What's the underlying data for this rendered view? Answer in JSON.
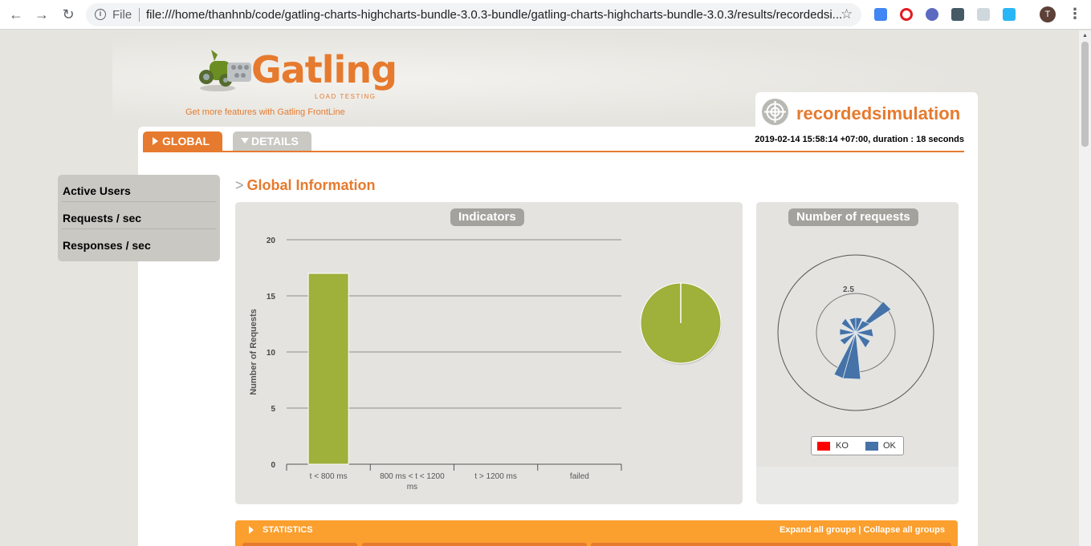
{
  "browser": {
    "scheme": "File",
    "url": "file:///home/thanhnb/code/gatling-charts-highcharts-bundle-3.0.3-bundle/gatling-charts-highcharts-bundle-3.0.3/results/recordedsi...",
    "avatar_letter": "T"
  },
  "header": {
    "logo_text": "Gatling",
    "logo_subtitle": "LOAD TESTING",
    "frontline_link": "Get more features with Gatling FrontLine",
    "simulation_name": "recordedsimulation",
    "accent_color": "#e67a2e"
  },
  "tabs": {
    "global": "GLOBAL",
    "details": "DETAILS"
  },
  "run_info": "2019-02-14 15:58:14 +07:00, duration : 18 seconds",
  "side_menu": [
    {
      "label": "Active Users"
    },
    {
      "label": "Requests / sec"
    },
    {
      "label": "Responses / sec"
    }
  ],
  "section": {
    "prefix": ">",
    "title": "Global Information"
  },
  "indicators_panel": {
    "title": "Indicators"
  },
  "requests_panel": {
    "title": "Number of requests",
    "legend": [
      {
        "label": "KO",
        "color": "#ff0000"
      },
      {
        "label": "OK",
        "color": "#4572a7"
      }
    ]
  },
  "statistics": {
    "title": "STATISTICS",
    "expand": "Expand all groups",
    "separator": "|",
    "collapse": "Collapse all groups"
  },
  "chart_data": [
    {
      "type": "bar",
      "ylabel": "Number of Requests",
      "categories": [
        "t < 800 ms",
        "800 ms < t < 1200 ms",
        "t > 1200 ms",
        "failed"
      ],
      "values": [
        17,
        0,
        0,
        0
      ],
      "ylim": [
        0,
        20
      ],
      "yticks": [
        "0",
        "5",
        "10",
        "15",
        "20"
      ],
      "grid": true,
      "color": "#9fb03b"
    },
    {
      "type": "pie",
      "series": [
        {
          "values": [
            17,
            0,
            0,
            0
          ]
        }
      ],
      "color": "#9fb03b"
    },
    {
      "type": "polar-area",
      "radial_tick": "2.5",
      "series": [
        {
          "name": "OK",
          "color": "#4572a7"
        },
        {
          "name": "KO",
          "color": "#ff0000"
        }
      ]
    }
  ]
}
